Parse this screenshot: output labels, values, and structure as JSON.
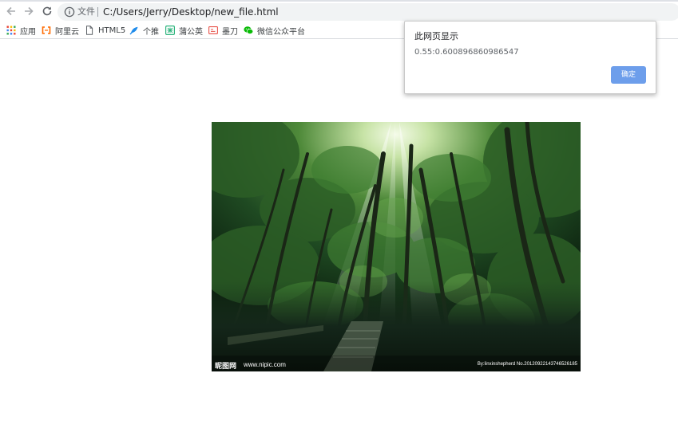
{
  "address_bar": {
    "security_label": "文件",
    "url": "C:/Users/Jerry/Desktop/new_file.html"
  },
  "bookmarks": [
    {
      "label": "应用",
      "icon": "apps-grid-icon"
    },
    {
      "label": "阿里云",
      "icon": "aliyun-icon"
    },
    {
      "label": "HTML5",
      "icon": "page-icon"
    },
    {
      "label": "个推",
      "icon": "getui-icon"
    },
    {
      "label": "蒲公英",
      "icon": "pgyer-icon"
    },
    {
      "label": "墨刀",
      "icon": "modao-icon"
    },
    {
      "label": "微信公众平台",
      "icon": "wechat-icon"
    }
  ],
  "alert": {
    "title": "此网页显示",
    "message": "0.55:0.600896860986547",
    "ok_label": "确定"
  },
  "image": {
    "watermark_brand": "昵图网",
    "watermark_site": "www.nipic.com",
    "watermark_credit": "By:linxinshepherd  No.20120922143746526185"
  },
  "colors": {
    "ok_button": "#6d9eeb",
    "omnibox_bg": "#f1f3f4"
  }
}
